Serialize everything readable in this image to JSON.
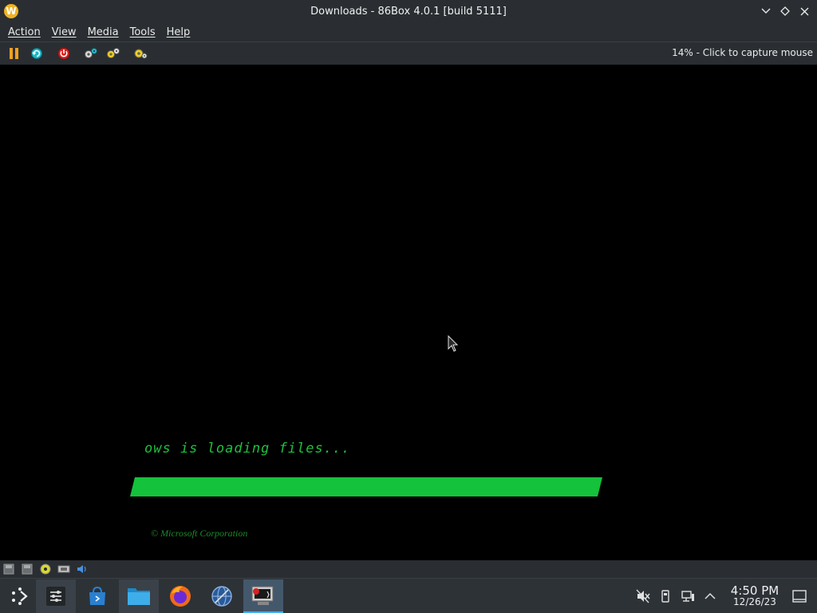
{
  "window": {
    "title": "Downloads - 86Box 4.0.1 [build 5111]",
    "app_icon_letter": "W"
  },
  "menu": {
    "items": [
      {
        "label": "Action"
      },
      {
        "label": "View"
      },
      {
        "label": "Media"
      },
      {
        "label": "Tools"
      },
      {
        "label": "Help"
      }
    ]
  },
  "toolbar": {
    "buttons": [
      "pause-icon",
      "reset-icon",
      "power-icon",
      "ctrl-alt-del-icon",
      "ctrl-alt-esc-icon",
      "settings-icon"
    ],
    "status": "14% - Click to capture mouse"
  },
  "screen": {
    "loading_text": "ows is loading files...",
    "progress_fraction": 1.0,
    "copyright": "© Microsoft Corporation",
    "colors": {
      "text": "#20c040",
      "bar": "#14c23b",
      "copyright": "#1a8a2a"
    }
  },
  "statusbar": {
    "icons": [
      "floppy-drive-icon",
      "floppy-drive-2-icon",
      "cdrom-icon",
      "network-icon",
      "sound-icon"
    ]
  },
  "taskbar": {
    "apps": [
      "app-launcher-icon",
      "system-settings-icon",
      "discover-store-icon",
      "file-manager-icon",
      "firefox-icon",
      "network-browser-icon",
      "86box-icon"
    ],
    "tray": [
      "audio-muted-icon",
      "usb-device-icon",
      "network-wired-icon",
      "tray-expand-icon",
      "show-desktop-icon"
    ],
    "clock": {
      "time": "4:50 PM",
      "date": "12/26/23"
    }
  },
  "colors": {
    "accent": "#3daee9",
    "panel": "#2a2e32"
  }
}
